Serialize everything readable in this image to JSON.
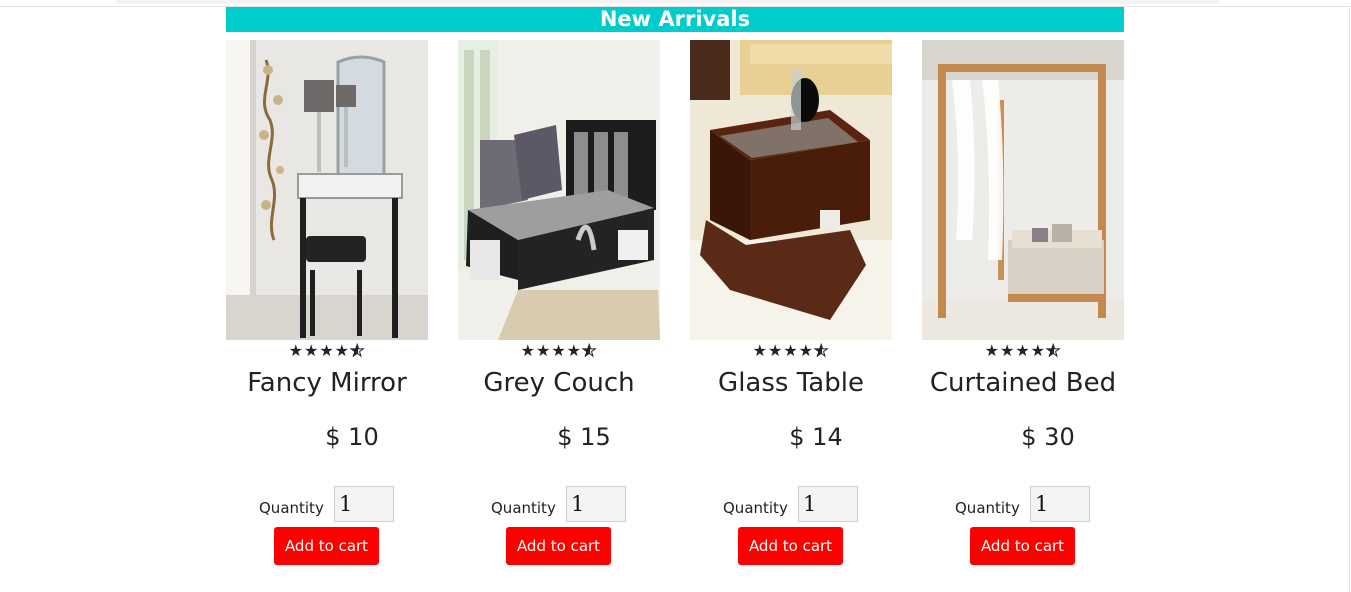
{
  "section": {
    "title": "New Arrivals"
  },
  "products": [
    {
      "name": "Fancy Mirror",
      "price": "$ 10",
      "rating_stars": 4.5,
      "rating_display": "★★★★",
      "quantity_label": "Quantity",
      "quantity_value": "1",
      "add_label": "Add to cart",
      "image_icon": "dressing-table-photo"
    },
    {
      "name": "Grey Couch",
      "price": "$ 15",
      "rating_stars": 4.5,
      "rating_display": "★★★★",
      "quantity_label": "Quantity",
      "quantity_value": "1",
      "add_label": "Add to cart",
      "image_icon": "sofa-photo"
    },
    {
      "name": "Glass Table",
      "price": "$ 14",
      "rating_stars": 4.5,
      "rating_display": "★★★★",
      "quantity_label": "Quantity",
      "quantity_value": "1",
      "add_label": "Add to cart",
      "image_icon": "coffee-table-photo"
    },
    {
      "name": "Curtained Bed",
      "price": "$ 30",
      "rating_stars": 4.5,
      "rating_display": "★★★★",
      "quantity_label": "Quantity",
      "quantity_value": "1",
      "add_label": "Add to cart",
      "image_icon": "canopy-bed-photo"
    }
  ],
  "colors": {
    "banner": "#00cccc",
    "button": "#ff0000",
    "text": "#222222"
  }
}
